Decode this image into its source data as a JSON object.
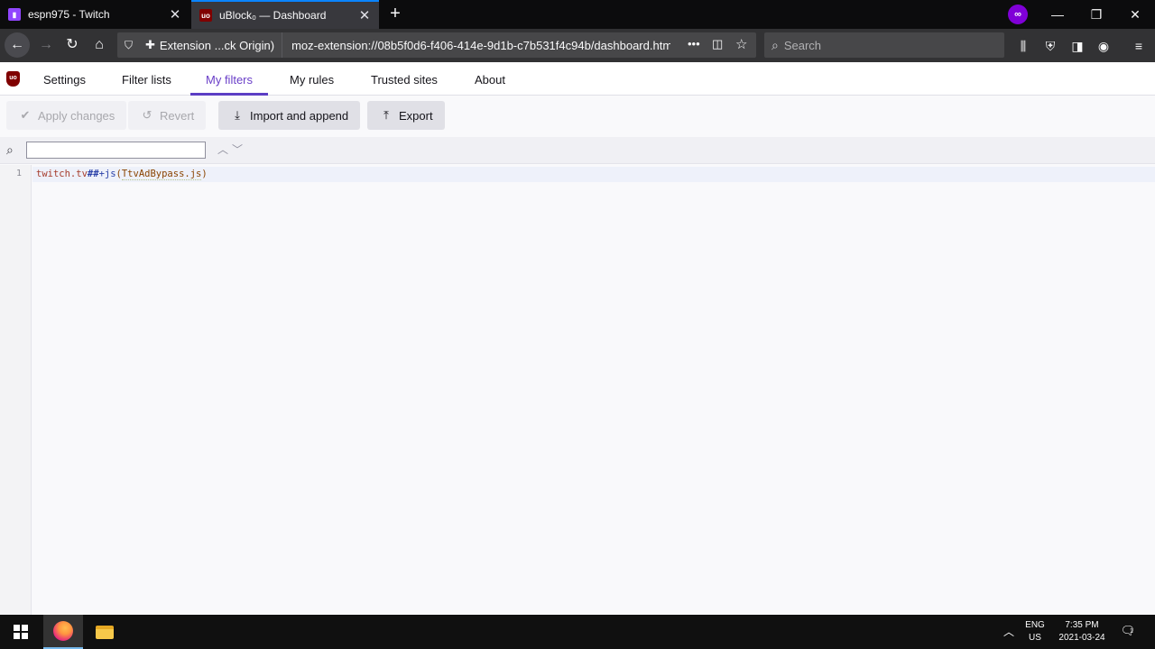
{
  "browser": {
    "tabs": [
      {
        "title": "espn975 - Twitch",
        "favicon": "twitch-icon",
        "color": "#9146ff"
      },
      {
        "title": "uBlock₀ — Dashboard",
        "favicon": "ublock-icon",
        "color": "#800000"
      }
    ],
    "urlbar": {
      "identity_label": "Extension ...ck Origin)",
      "url": "moz-extension://08b5f0d6-f406-414e-9d1b-c7b531f4c94b/dashboard.html"
    },
    "search_placeholder": "Search",
    "accent": "#0a84ff"
  },
  "dashboard": {
    "tabs": [
      "Settings",
      "Filter lists",
      "My filters",
      "My rules",
      "Trusted sites",
      "About"
    ],
    "active_tab": "My filters",
    "active_color": "#5b3dc4",
    "buttons": {
      "apply": "Apply changes",
      "revert": "Revert",
      "import": "Import and append",
      "export": "Export"
    },
    "find_value": "",
    "editor": {
      "line_number": "1",
      "tokens": {
        "host": "twitch.tv",
        "sep": "##",
        "scriptlet": "+js",
        "open": "(",
        "arg": "TtvAdBypass.js",
        "close": ")"
      }
    }
  },
  "taskbar": {
    "lang_top": "ENG",
    "lang_bottom": "US",
    "time": "7:35 PM",
    "date": "2021-03-24",
    "notification_count": "1"
  }
}
